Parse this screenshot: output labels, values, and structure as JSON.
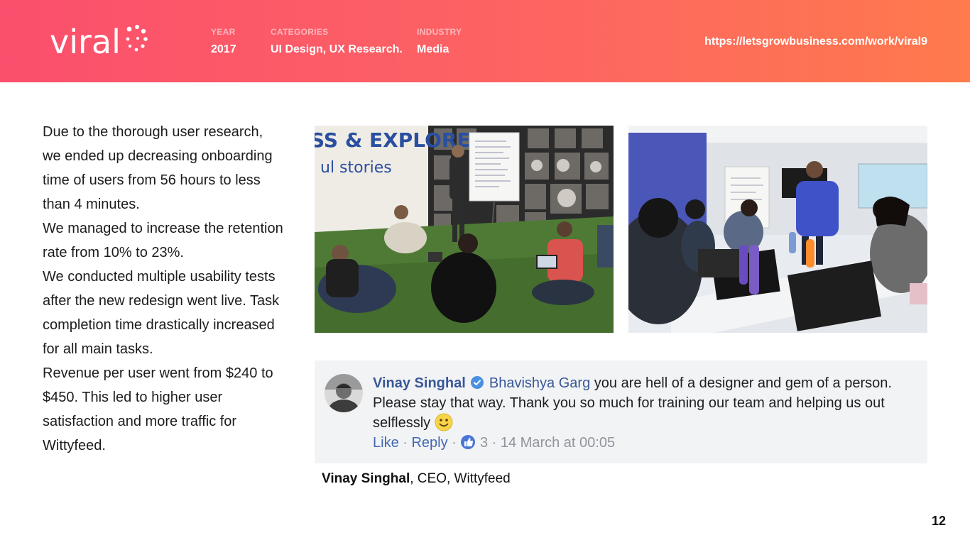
{
  "header": {
    "logo_text": "viral",
    "year": {
      "label": "YEAR",
      "value": "2017"
    },
    "categories": {
      "label": "CATEGORIES",
      "value": "UI Design, UX Research."
    },
    "industry": {
      "label": "INDUSTRY",
      "value": "Media"
    },
    "url": "https://letsgrowbusiness.com/work/viral9"
  },
  "body": {
    "paragraphs": [
      "Due to the thorough user research, we ended up decreasing onboarding time of users from 56 hours to less than 4 minutes.",
      "We managed to increase the retention rate from 10% to 23%.",
      "We conducted multiple usability tests after the new redesign went live. Task completion time drastically increased for all main tasks.",
      "Revenue per user went from $240 to $450. This led to higher user satisfaction and more traffic for Wittyfeed."
    ]
  },
  "photos": [
    {
      "icon": "workshop-photo",
      "wall_text_1": "SS & EXPLORE",
      "wall_text_2": "ul stories"
    },
    {
      "icon": "meeting-room-photo"
    }
  ],
  "comment": {
    "author": "Vinay Singhal",
    "verified_icon": "verified-badge-icon",
    "mention": "Bhavishya Garg",
    "text": " you are hell of a designer and gem of a person. Please stay that way. Thank you so much for training our team and helping us out selflessly ",
    "emoji_icon": "smiley-emoji-icon",
    "like_label": "Like",
    "separator": " · ",
    "reply_label": "Reply",
    "like_count": "3",
    "timestamp": "14 March at 00:05"
  },
  "attribution": {
    "name": "Vinay Singhal",
    "role": ", CEO, Wittyfeed"
  },
  "page_number": "12",
  "colors": {
    "header_gradient_start": "#fb4f6d",
    "header_gradient_end": "#ff7a4d",
    "facebook_blue": "#385898",
    "comment_bg": "#f2f3f5"
  }
}
